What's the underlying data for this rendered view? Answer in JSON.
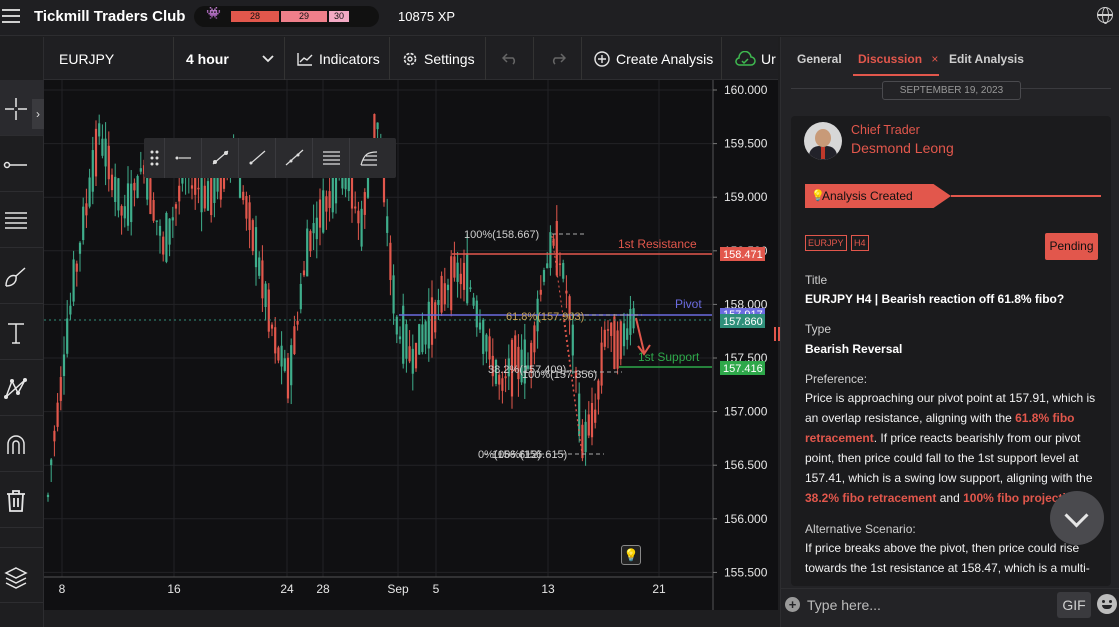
{
  "header": {
    "app_title": "Tickmill Traders Club",
    "xp_segments": [
      "28",
      "29",
      "30"
    ],
    "xp_label": "10875 XP"
  },
  "chart_toolbar": {
    "symbol": "EURJPY",
    "timeframe": "4 hour",
    "indicators": "Indicators",
    "settings": "Settings",
    "create_analysis": "Create Analysis",
    "truncated_button": "Ur"
  },
  "chart": {
    "price_ticks": [
      "160.000",
      "159.500",
      "159.000",
      "158.500",
      "158.000",
      "157.500",
      "157.000",
      "156.500",
      "156.000",
      "155.500"
    ],
    "date_ticks": [
      "8",
      "16",
      "24",
      "28",
      "Sep",
      "5",
      "13",
      "21"
    ],
    "resistance_label": "1st Resistance",
    "resistance_price": "158.471",
    "pivot_label": "Pivot",
    "pivot_price": "157.917",
    "current_price": "157.860",
    "support_label": "1st Support",
    "support_price": "157.416",
    "fib_top": "100%(158.667)",
    "fib_mid_a": "61.8%(157.903)",
    "fib_mid_b": "38.2%(157.409)",
    "fib_mid_c": "100%(157.356)",
    "fib_bottom": "0%(156.612)",
    "fib_bottom_b": "100%(156.615)"
  },
  "panel": {
    "tabs": [
      "General",
      "Discussion",
      "Edit Analysis"
    ],
    "tab_close": "×",
    "date": "SEPTEMBER 19, 2023",
    "role": "Chief Trader",
    "author": "Desmond Leong",
    "status_banner": "Analysis Created",
    "tags": [
      "EURJPY",
      "H4"
    ],
    "pending": "Pending",
    "title_label": "Title",
    "title_value": "EURJPY H4 | Bearish reaction off 61.8% fibo?",
    "type_label": "Type",
    "type_value": "Bearish Reversal",
    "preference_label": "Preference:",
    "preference_text_1": "Price is approaching our pivot point at 157.91, which is an overlap resistance, aligning with the ",
    "preference_hl_1": "61.8% fibo retracement",
    "preference_text_2": ". If price reacts bearishly from our pivot point, then price could fall to the 1st support level at 157.41, which is a swing low support, aligning with the ",
    "preference_hl_2": "38.2% fibo retracement",
    "preference_text_3": " and ",
    "preference_hl_3": "100% fibo projecti",
    "alt_label": "Alternative Scenario:",
    "alt_text": "If price breaks above the pivot, then price could rise towards the 1st resistance at 158.47, which is a multi-",
    "input_placeholder": "Type here...",
    "gif": "GIF"
  },
  "colors": {
    "accent": "#e2574c",
    "bull": "#3fae8c",
    "bear": "#e2574c",
    "pivot": "#6b6be0",
    "support": "#2ea84a"
  },
  "icons": [
    "menu-icon",
    "globe-icon",
    "crosshair-icon",
    "horizontal-line-icon",
    "fib-lines-icon",
    "brush-icon",
    "text-icon",
    "pattern-icon",
    "magnet-icon",
    "trash-icon",
    "layers-icon",
    "chevron-down-icon",
    "indicators-icon",
    "gear-icon",
    "undo-icon",
    "redo-icon",
    "plus-circle-icon",
    "cloud-check-icon",
    "bulb-icon",
    "close-icon",
    "emoji-icon"
  ]
}
